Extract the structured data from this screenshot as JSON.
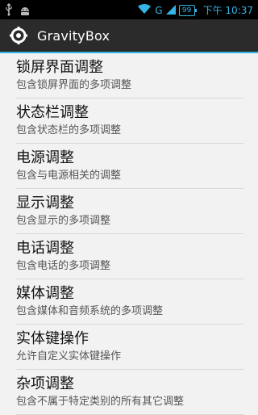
{
  "status_bar": {
    "time": "下午 10:37",
    "network": "G",
    "battery": "99",
    "accent": "#33b5e5"
  },
  "action_bar": {
    "title": "GravityBox",
    "icon": "gear-icon"
  },
  "items": [
    {
      "title": "锁屏界面调整",
      "summary": "包含锁屏界面的多项调整"
    },
    {
      "title": "状态栏调整",
      "summary": "包含状态栏的多项调整"
    },
    {
      "title": "电源调整",
      "summary": "包含与电源相关的调整"
    },
    {
      "title": "显示调整",
      "summary": "包含显示的多项调整"
    },
    {
      "title": "电话调整",
      "summary": "包含电话的多项调整"
    },
    {
      "title": "媒体调整",
      "summary": "包含媒体和音频系统的多项调整"
    },
    {
      "title": "实体键操作",
      "summary": "允许自定义实体键操作"
    },
    {
      "title": "杂项调整",
      "summary": "包含不属于特定类别的所有其它调整"
    }
  ]
}
